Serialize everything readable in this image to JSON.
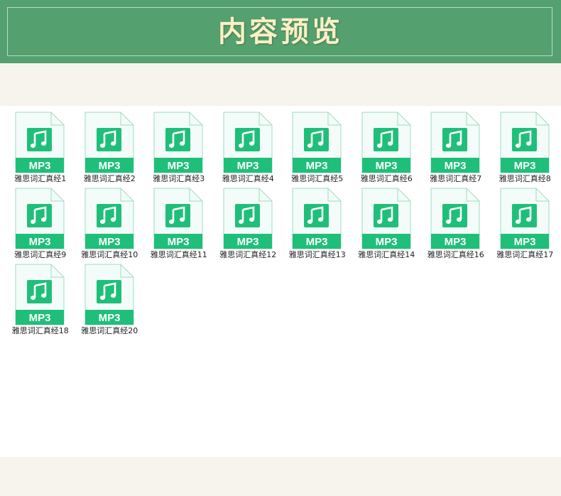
{
  "header": {
    "title": "内容预览"
  },
  "colors": {
    "header_green": "#55a06f",
    "title_cream": "#fbf0c4",
    "mp3_green": "#1fbf7a",
    "page_cream": "#f7f4ee"
  },
  "files": [
    {
      "name": "雅思词汇真经1",
      "type": "MP3",
      "icon": "music-note-icon"
    },
    {
      "name": "雅思词汇真经2",
      "type": "MP3",
      "icon": "music-note-icon"
    },
    {
      "name": "雅思词汇真经3",
      "type": "MP3",
      "icon": "music-note-icon"
    },
    {
      "name": "雅思词汇真经4",
      "type": "MP3",
      "icon": "music-note-icon"
    },
    {
      "name": "雅思词汇真经5",
      "type": "MP3",
      "icon": "music-note-icon"
    },
    {
      "name": "雅思词汇真经6",
      "type": "MP3",
      "icon": "music-note-icon"
    },
    {
      "name": "雅思词汇真经7",
      "type": "MP3",
      "icon": "music-note-icon"
    },
    {
      "name": "雅思词汇真经8",
      "type": "MP3",
      "icon": "music-note-icon"
    },
    {
      "name": "雅思词汇真经9",
      "type": "MP3",
      "icon": "music-note-icon"
    },
    {
      "name": "雅思词汇真经10",
      "type": "MP3",
      "icon": "music-note-icon"
    },
    {
      "name": "雅思词汇真经11",
      "type": "MP3",
      "icon": "music-note-icon"
    },
    {
      "name": "雅思词汇真经12",
      "type": "MP3",
      "icon": "music-note-icon"
    },
    {
      "name": "雅思词汇真经13",
      "type": "MP3",
      "icon": "music-note-icon"
    },
    {
      "name": "雅思词汇真经14",
      "type": "MP3",
      "icon": "music-note-icon"
    },
    {
      "name": "雅思词汇真经16",
      "type": "MP3",
      "icon": "music-note-icon"
    },
    {
      "name": "雅思词汇真经17",
      "type": "MP3",
      "icon": "music-note-icon"
    },
    {
      "name": "雅思词汇真经18",
      "type": "MP3",
      "icon": "music-note-icon"
    },
    {
      "name": "雅思词汇真经20",
      "type": "MP3",
      "icon": "music-note-icon"
    }
  ]
}
